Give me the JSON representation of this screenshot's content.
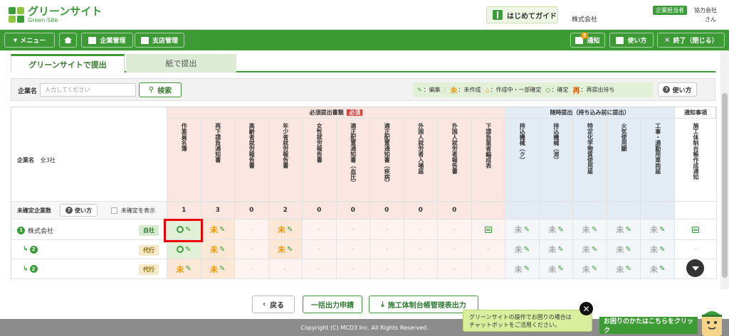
{
  "header": {
    "logo_text": "グリーンサイト",
    "logo_sub": "Green-Site",
    "guide_label": "はじめてガイド",
    "company": "株式会社",
    "role_badge": "企業担当者",
    "partner": "協力会社",
    "honorific": "さん"
  },
  "nav": {
    "menu": "メニュー",
    "kigyo": "企業管理",
    "shiten": "支店管理",
    "notice": "通知",
    "notice_count": "5",
    "usage": "使い方",
    "close": "終了（閉じる）"
  },
  "tabs": {
    "active": "グリーンサイトで提出",
    "inactive": "紙で提出"
  },
  "search": {
    "label": "企業名",
    "placeholder": "入力してください",
    "button": "検索"
  },
  "legend": {
    "edit": "：編集",
    "mi_mark": "未",
    "mi_text": "：未作成",
    "tri_mark": "△",
    "tri_text": "：作成中・一部確定",
    "ok_mark": "○",
    "ok_text": "：確定",
    "sai_mark": "再",
    "sai_text": "：再提出待ち",
    "usage": "使い方"
  },
  "table": {
    "group_required": "必須提出書類",
    "required_badge": "必須",
    "group_temporary": "随時提出（持ち込み前に提出）",
    "group_notice": "通知事項",
    "company_col": "企業名",
    "company_count": "全3社",
    "unconfirmed_label": "未確定企業数",
    "usage": "使い方",
    "show_unconfirmed": "未確定を表示",
    "columns": [
      "作業員名簿",
      "再下請負通知書",
      "高齢者就労報告書",
      "年少者就労報告書",
      "女性就労報告書",
      "適正配置通知書（血圧）",
      "適正配置通知書（疾病）",
      "外国人就労者入場届",
      "外国人就労者報告書",
      "下請負業者編成表",
      "持込機械（ク）",
      "持込機械（溶）",
      "特定化学物質使用届",
      "火気使用願",
      "工事・通勤用車両届",
      "施工体制台帳作成通知"
    ],
    "counts": [
      "1",
      "3",
      "0",
      "2",
      "0",
      "0",
      "0",
      "0",
      "0",
      "",
      "",
      "",
      "",
      "",
      "",
      ""
    ],
    "rows": [
      {
        "num": "1",
        "name": "株式会社",
        "type": "自社",
        "cells": [
          "ok",
          "mi",
          "-",
          "mi",
          "-",
          "-",
          "-",
          "-",
          "-",
          "list",
          "mig",
          "mig",
          "mig",
          "mig",
          "mig",
          "list"
        ]
      },
      {
        "num": "2",
        "name": "",
        "type": "代行",
        "cells": [
          "ok",
          "mi",
          "-",
          "mi",
          "-",
          "-",
          "-",
          "-",
          "-",
          "-",
          "mig",
          "mig",
          "mig",
          "mig",
          "mig",
          "-"
        ]
      },
      {
        "num": "2",
        "name": "",
        "type": "代行",
        "cells": [
          "mi",
          "mi",
          "-",
          "-",
          "-",
          "-",
          "-",
          "-",
          "-",
          "-",
          "mig",
          "mig",
          "mig",
          "mig",
          "mig",
          "-"
        ]
      }
    ]
  },
  "bottom": {
    "back": "戻る",
    "batch": "一括出力申請",
    "export": "施工体制台帳管理表出力"
  },
  "footer": "Copyright (C) MCD3 Inc. All Rights Reserved.",
  "chat": {
    "bubble_line1": "グリーンサイトの操作でお困りの場合は",
    "bubble_line2": "チャットボットをご活用ください。",
    "button": "お困りのかたはこちらをクリック"
  },
  "colors": {
    "brand_green": "#3d9b35",
    "required_bg": "#fbe6e1",
    "temporary_bg": "#e3ecf5",
    "pending_orange": "#f39800"
  }
}
